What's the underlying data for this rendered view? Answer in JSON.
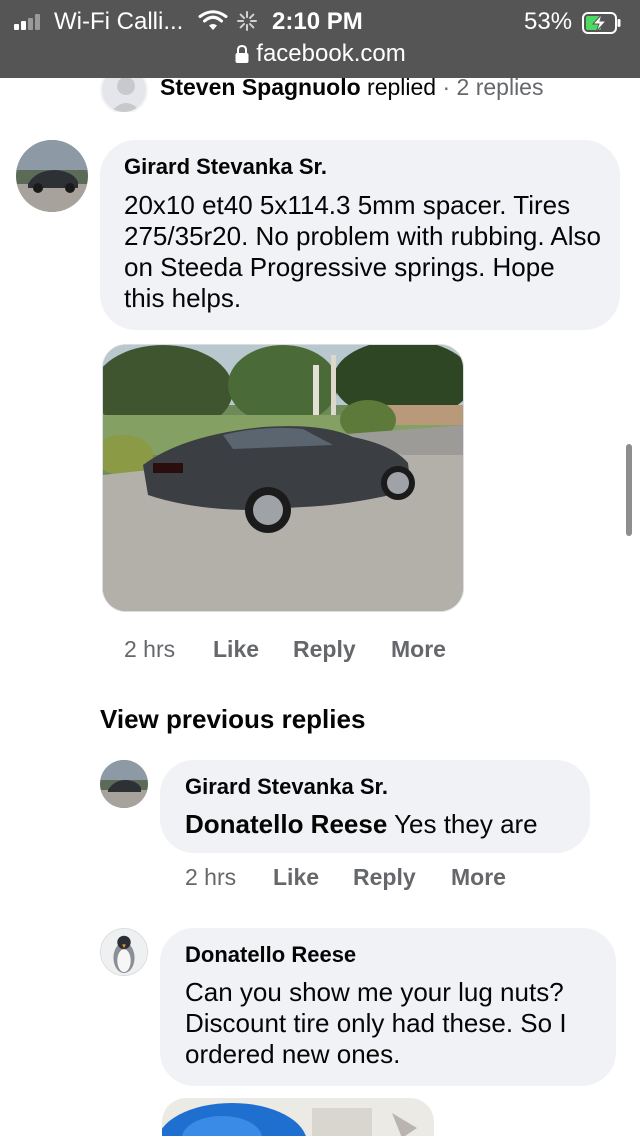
{
  "status_bar": {
    "carrier": "Wi-Fi Calli...",
    "time": "2:10 PM",
    "battery": "53%",
    "icons": [
      "signal-icon",
      "wifi-icon",
      "loading-spinner-icon",
      "battery-charging-icon"
    ]
  },
  "address_bar": {
    "url": "facebook.com",
    "icon": "lock-icon"
  },
  "partial_reply": {
    "name": "Steven Spagnuolo",
    "verb": "replied",
    "separator": "·",
    "count": "2 replies"
  },
  "comment_1": {
    "author": "Girard Stevanka Sr.",
    "text": "20x10 et40 5x114.3 5mm spacer. Tires 275/35r20. No problem with rubbing. Also on Steeda Progressive springs. Hope this helps.",
    "time": "2 hrs",
    "like": "Like",
    "reply": "Reply",
    "more": "More"
  },
  "view_previous": "View previous replies",
  "reply_1": {
    "author": "Girard Stevanka Sr.",
    "mention": "Donatello Reese",
    "text": "Yes they are",
    "time": "2 hrs",
    "like": "Like",
    "reply": "Reply",
    "more": "More"
  },
  "reply_2": {
    "author": "Donatello Reese",
    "text": "Can you show me your lug nuts? Discount tire only had these. So I ordered new ones."
  },
  "colors": {
    "status_bar": "#555556",
    "bubble": "#f0f2f5",
    "meta_text": "#65676b",
    "battery_green": "#4cd964"
  }
}
